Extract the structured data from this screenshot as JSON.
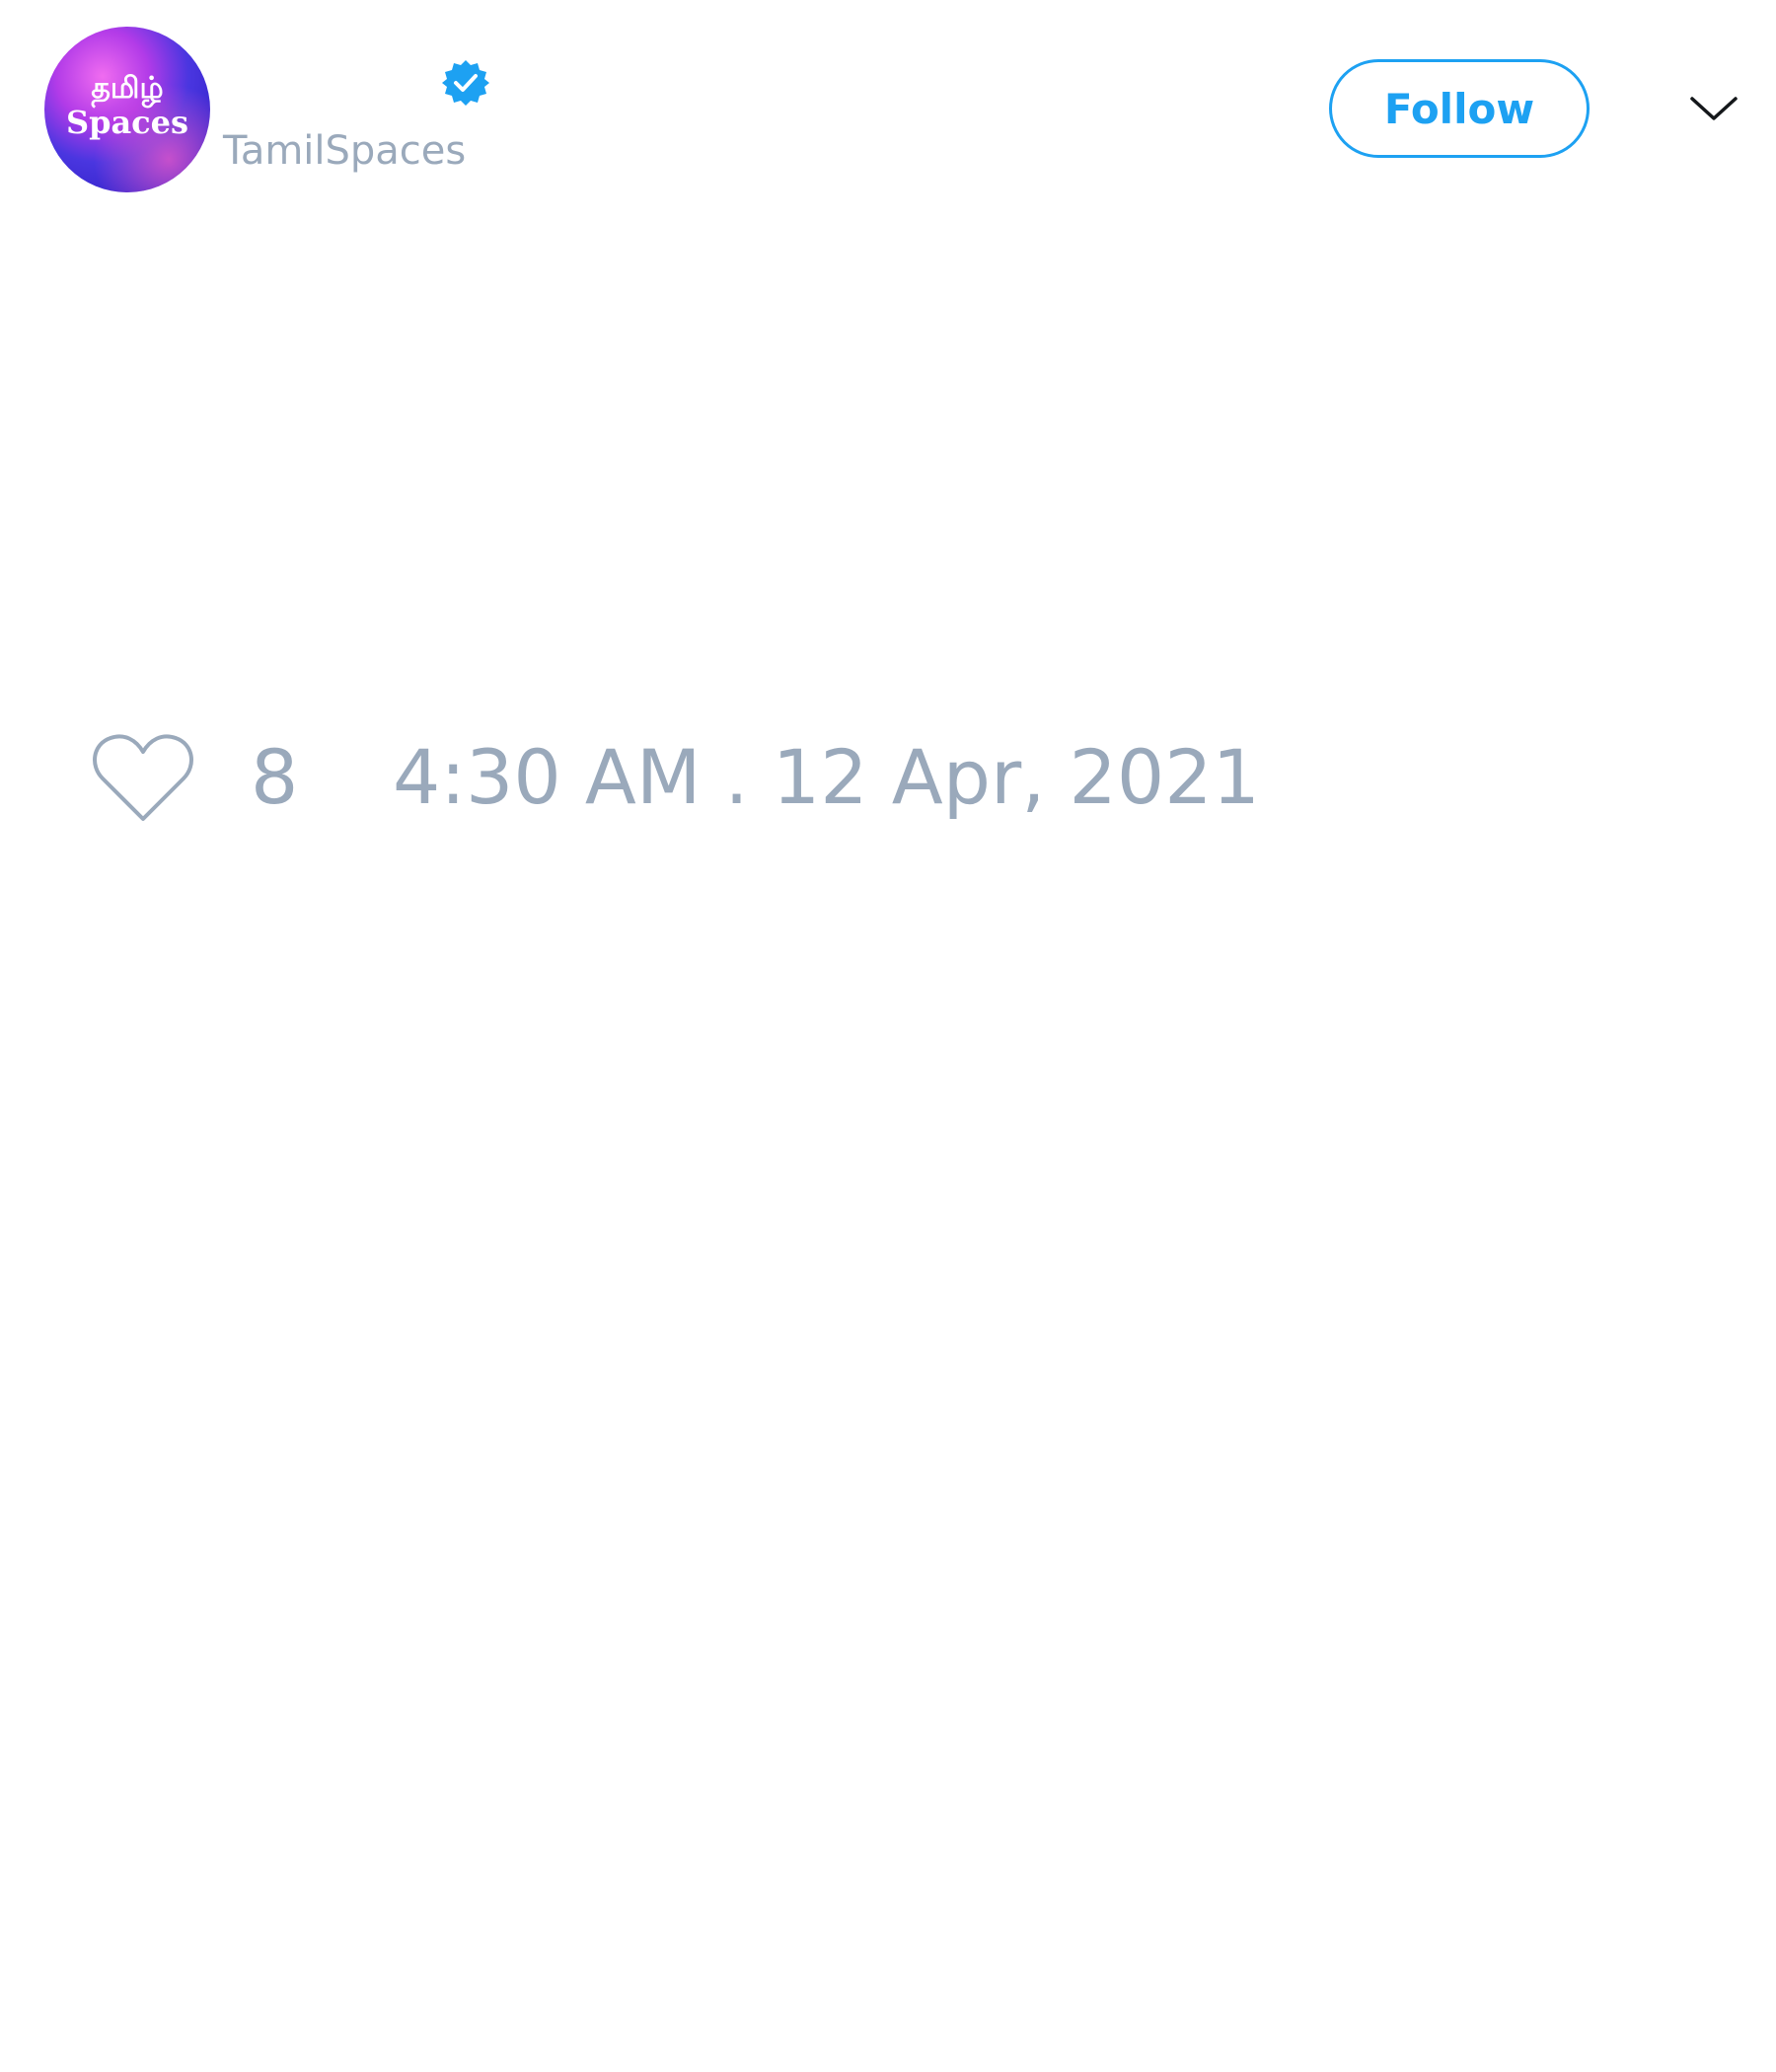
{
  "profile": {
    "avatar_text_line1": "தமிழ்",
    "avatar_text_line2": "Spaces",
    "handle": "TamilSpaces",
    "verified": true
  },
  "actions": {
    "follow_label": "Follow",
    "menu_icon": "chevron-down-icon"
  },
  "tweet": {
    "like_icon": "heart-outline-icon",
    "like_count": "8",
    "timestamp": "4:30 AM . 12 Apr, 2021"
  },
  "colors": {
    "accent": "#1da1f2",
    "muted_text": "#9aa9bb",
    "background": "#ffffff"
  }
}
